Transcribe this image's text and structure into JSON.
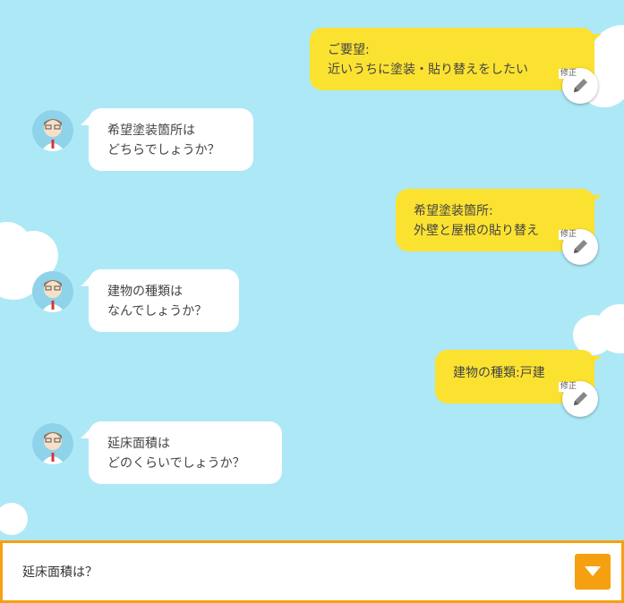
{
  "conversation": [
    {
      "role": "user",
      "lines": [
        "ご要望:",
        "近いうちに塗装・貼り替えをしたい"
      ],
      "edit_label": "修正"
    },
    {
      "role": "bot",
      "lines": [
        "希望塗装箇所は",
        "どちらでしょうか？"
      ]
    },
    {
      "role": "user",
      "lines": [
        "希望塗装箇所:",
        "外壁と屋根の貼り替え"
      ],
      "edit_label": "修正"
    },
    {
      "role": "bot",
      "lines": [
        "建物の種類は",
        "なんでしょうか？"
      ]
    },
    {
      "role": "user",
      "lines": [
        "建物の種類:戸建"
      ],
      "edit_label": "修正"
    },
    {
      "role": "bot",
      "lines": [
        "延床面積は",
        "どのくらいでしょうか？"
      ]
    }
  ],
  "bottom_bar": {
    "current_question": "延床面積は？",
    "dropdown_icon": "chevron-down-icon"
  },
  "colors": {
    "background": "#ade8f6",
    "user_bubble": "#fbe231",
    "bot_bubble": "#ffffff",
    "accent": "#f5a011"
  }
}
